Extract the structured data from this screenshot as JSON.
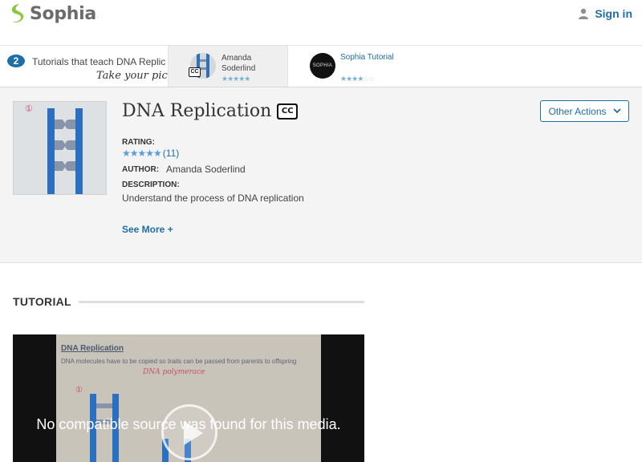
{
  "brand": {
    "name": "Sophia",
    "tm": "."
  },
  "header": {
    "signin_label": "Sign in"
  },
  "tutorials_strip": {
    "count": "2",
    "title": "Tutorials that teach DNA Replic",
    "pick_label": "Take your pick:",
    "cards": [
      {
        "author_line1": "Amanda",
        "author_line2": "Soderlind",
        "stars": "★★★★★",
        "cc": "CC"
      },
      {
        "author": "Sophia Tutorial",
        "thumb_text": "SOPHIA",
        "stars_filled": "★★★★",
        "stars_empty": "☆☆"
      }
    ]
  },
  "summary": {
    "title": "DNA Replication",
    "cc_label": "CC",
    "rating_label": "RATING:",
    "rating_stars": "★★★★★",
    "rating_count": "(11)",
    "author_label": "AUTHOR:",
    "author_value": "Amanda Soderlind",
    "description_label": "DESCRIPTION:",
    "description_value": "Understand the process of DNA replication",
    "see_more_label": "See More +",
    "other_actions_label": "Other Actions"
  },
  "tutorial_section": {
    "title": "TUTORIAL",
    "slide_title": "DNA Replication",
    "slide_text": "DNA molecules have to be copied so traits can be passed from parents to offspring",
    "slide_handwriting": "DNA polymerace",
    "video_message": "No compatible source was found for this media."
  },
  "colors": {
    "accent": "#1e6ea8",
    "brand_green": "#8cc63f",
    "panel_bg": "#f4f4f4"
  },
  "icons": [
    "sophia-logo-icon",
    "user-icon",
    "chevron-down-icon",
    "play-icon",
    "cc-icon"
  ]
}
